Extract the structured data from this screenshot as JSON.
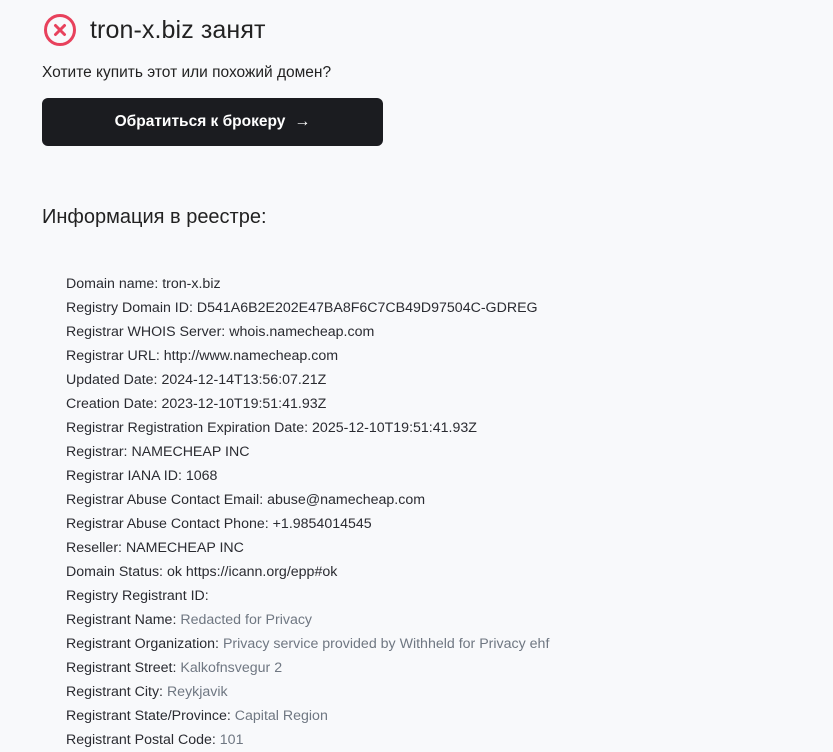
{
  "status": {
    "icon": "x-circle-icon",
    "color": "#e8415c",
    "title": "tron-x.biz занят"
  },
  "prompt": {
    "question": "Хотите купить этот или похожий домен?",
    "broker_button_label": "Обратиться к брокеру",
    "broker_button_arrow": "→"
  },
  "registry": {
    "title": "Информация в реестре:",
    "rows": [
      {
        "key": "Domain name:",
        "value": "tron-x.biz",
        "muted": false
      },
      {
        "key": "Registry Domain ID:",
        "value": "D541A6B2E202E47BA8F6C7CB49D97504C-GDREG",
        "muted": false
      },
      {
        "key": "Registrar WHOIS Server:",
        "value": "whois.namecheap.com",
        "muted": false
      },
      {
        "key": "Registrar URL:",
        "value": "http://www.namecheap.com",
        "muted": false
      },
      {
        "key": "Updated Date:",
        "value": "2024-12-14T13:56:07.21Z",
        "muted": false
      },
      {
        "key": "Creation Date:",
        "value": "2023-12-10T19:51:41.93Z",
        "muted": false
      },
      {
        "key": "Registrar Registration Expiration Date:",
        "value": "2025-12-10T19:51:41.93Z",
        "muted": false
      },
      {
        "key": "Registrar:",
        "value": "NAMECHEAP INC",
        "muted": false
      },
      {
        "key": "Registrar IANA ID:",
        "value": "1068",
        "muted": false
      },
      {
        "key": "Registrar Abuse Contact Email:",
        "value": "abuse@namecheap.com",
        "muted": false
      },
      {
        "key": "Registrar Abuse Contact Phone:",
        "value": "+1.9854014545",
        "muted": false
      },
      {
        "key": "Reseller:",
        "value": "NAMECHEAP INC",
        "muted": false
      },
      {
        "key": "Domain Status:",
        "value": "ok https://icann.org/epp#ok",
        "muted": false
      },
      {
        "key": "Registry Registrant ID:",
        "value": "",
        "muted": false
      },
      {
        "key": "Registrant Name:",
        "value": "Redacted for Privacy",
        "muted": true
      },
      {
        "key": "Registrant Organization:",
        "value": "Privacy service provided by Withheld for Privacy ehf",
        "muted": true
      },
      {
        "key": "Registrant Street:",
        "value": "Kalkofnsvegur 2",
        "muted": true
      },
      {
        "key": "Registrant City:",
        "value": "Reykjavik",
        "muted": true
      },
      {
        "key": "Registrant State/Province:",
        "value": "Capital Region",
        "muted": true
      },
      {
        "key": "Registrant Postal Code:",
        "value": "101",
        "muted": true
      }
    ]
  }
}
